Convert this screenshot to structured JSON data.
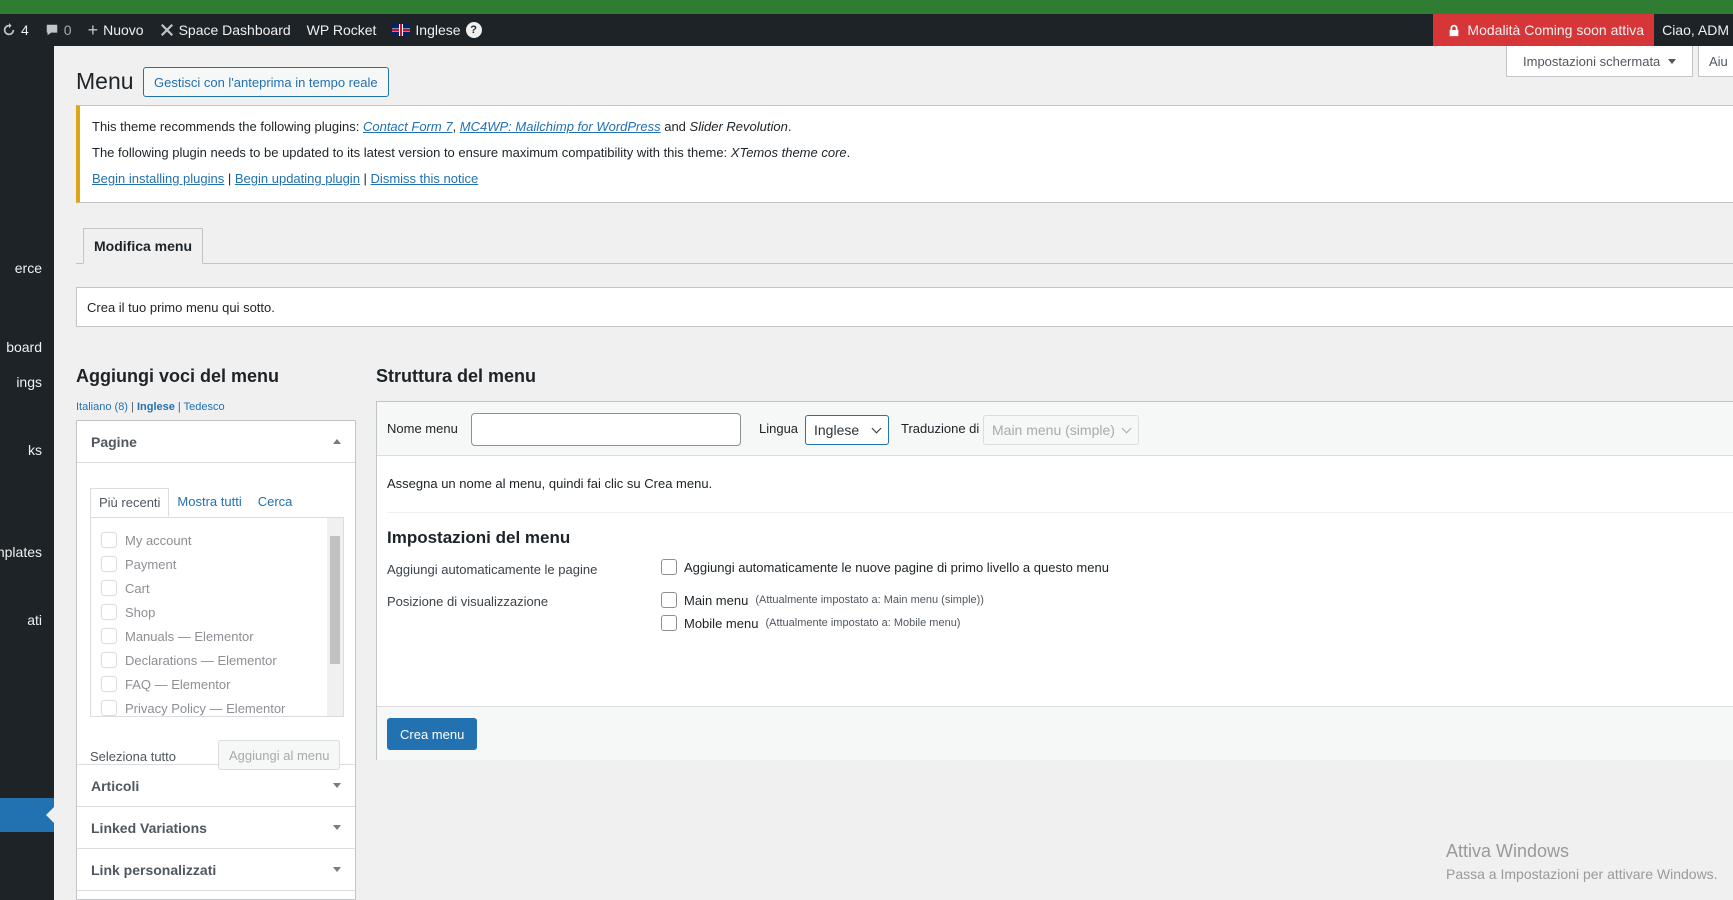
{
  "adminbar": {
    "updates_count": "4",
    "comments_count": "0",
    "new_label": "Nuovo",
    "space_dashboard": "Space Dashboard",
    "wp_rocket": "WP Rocket",
    "language": "Inglese",
    "help_mark": "?",
    "coming_soon": "Modalità Coming soon attiva",
    "greeting": "Ciao, ADM"
  },
  "sidebar": {
    "items": [
      "erce",
      "board",
      "ings",
      "ks",
      "nplates",
      "ati"
    ]
  },
  "header": {
    "title": "Menu",
    "live_preview_button": "Gestisci con l'anteprima in tempo reale",
    "screen_options": "Impostazioni schermata",
    "help": "Aiu"
  },
  "notice": {
    "line1_prefix": "This theme recommends the following plugins: ",
    "plugin1": "Contact Form 7",
    "sep1": ", ",
    "plugin2": "MC4WP: Mailchimp for WordPress",
    "and": " and ",
    "plugin3": "Slider Revolution",
    "period": ".",
    "line2_prefix": "The following plugin needs to be updated to its latest version to ensure maximum compatibility with this theme: ",
    "plugin4": "XTemos theme core",
    "link_install": "Begin installing plugins",
    "pipe": " | ",
    "link_update": "Begin updating plugin",
    "link_dismiss": "Dismiss this notice"
  },
  "tabs": {
    "edit_menu": "Modifica menu"
  },
  "info_box": "Crea il tuo primo menu qui sotto.",
  "left": {
    "heading": "Aggiungi voci del menu",
    "lang_italian": "Italiano (8)",
    "lang_sep": " | ",
    "lang_english": "Inglese",
    "lang_german": "Tedesco",
    "pages_title": "Pagine",
    "tab_recent": "Più recenti",
    "tab_all": "Mostra tutti",
    "tab_search": "Cerca",
    "pages": [
      "My account",
      "Payment",
      "Cart",
      "Shop",
      "Manuals — Elementor",
      "Declarations — Elementor",
      "FAQ — Elementor",
      "Privacy Policy — Elementor"
    ],
    "select_all": "Seleziona tutto",
    "add_to_menu": "Aggiungi al menu",
    "accordions": [
      "Articoli",
      "Linked Variations",
      "Link personalizzati"
    ]
  },
  "right": {
    "heading": "Struttura del menu",
    "menu_name_label": "Nome menu",
    "menu_name_value": "",
    "language_label": "Lingua",
    "language_value": "Inglese",
    "translation_label": "Traduzione di",
    "translation_value": "Main menu (simple)",
    "instructions": "Assegna un nome al menu, quindi fai clic su Crea menu.",
    "settings_heading": "Impostazioni del menu",
    "auto_add_label": "Aggiungi automaticamente le pagine",
    "auto_add_option": "Aggiungi automaticamente le nuove pagine di primo livello a questo menu",
    "display_location_label": "Posizione di visualizzazione",
    "location_main": "Main menu",
    "location_main_note": "(Attualmente impostato a: Main menu (simple))",
    "location_mobile": "Mobile menu",
    "location_mobile_note": "(Attualmente impostato a: Mobile menu)",
    "create_button": "Crea menu"
  },
  "watermark": {
    "line1": "Attiva Windows",
    "line2": "Passa a Impostazioni per attivare Windows."
  },
  "colors": {
    "accent": "#2271b1",
    "adminbar": "#1d2327",
    "notice_border": "#dba617",
    "coming_soon_bg": "#d63638"
  }
}
